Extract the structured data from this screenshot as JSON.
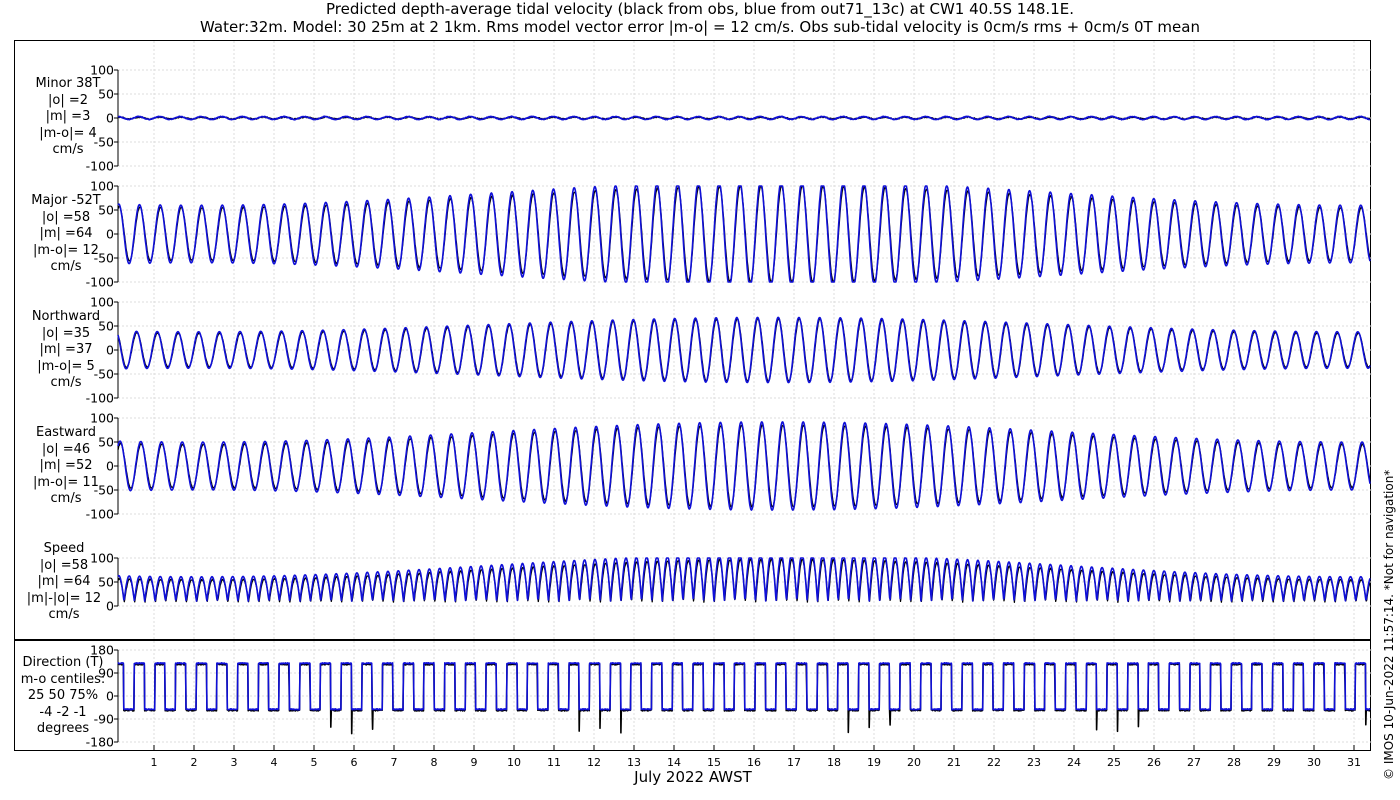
{
  "title_line1": "Predicted depth-average tidal velocity (black from obs, blue from out71_13c) at CW1 40.5S 148.1E.",
  "title_line2": "Water:32m. Model: 30 25m at 2 1km. Rms model vector error |m-o| = 12 cm/s. Obs sub-tidal velocity is 0cm/s rms + 0cm/s 0T mean",
  "watermark": "© IMOS 10-Jun-2022 11:57:14. *Not for navigation*",
  "panels": [
    {
      "key": "minor",
      "labels": [
        "Minor 38T",
        "|o| =2",
        "|m| =3",
        "|m-o|= 4",
        "cm/s"
      ]
    },
    {
      "key": "major",
      "labels": [
        "Major -52T",
        "|o| =58",
        "|m| =64",
        "|m-o|= 12",
        "cm/s"
      ]
    },
    {
      "key": "north",
      "labels": [
        "Northward",
        "|o| =35",
        "|m| =37",
        "|m-o|= 5",
        "cm/s"
      ]
    },
    {
      "key": "east",
      "labels": [
        "Eastward",
        "|o| =46",
        "|m| =52",
        "|m-o|= 11",
        "cm/s"
      ]
    },
    {
      "key": "speed",
      "labels": [
        "Speed",
        "|o| =58",
        "|m| =64",
        "|m|-|o|= 12",
        "cm/s"
      ]
    },
    {
      "key": "direction",
      "labels": [
        "Direction (T)",
        "m-o centiles:",
        "25  50  75%",
        "-4 -2 -1",
        "degrees"
      ]
    }
  ],
  "chart_data": {
    "type": "line",
    "xlabel": "July 2022 AWST",
    "x_ticks": [
      "1",
      "2",
      "3",
      "4",
      "5",
      "6",
      "7",
      "8",
      "9",
      "10",
      "11",
      "12",
      "13",
      "14",
      "15",
      "16",
      "17",
      "18",
      "19",
      "20",
      "21",
      "22",
      "23",
      "24",
      "25",
      "26",
      "27",
      "28",
      "29",
      "30",
      "31"
    ],
    "series_colors": {
      "obs": "#000000",
      "model": "#1010d8"
    },
    "grid": true,
    "panels": [
      {
        "name": "Minor 38T",
        "ylim": [
          -100,
          100
        ],
        "yticks": [
          "100",
          "50",
          "0",
          "-50",
          "-100"
        ],
        "obs_amplitude": 2,
        "model_amplitude": 3
      },
      {
        "name": "Major -52T",
        "ylim": [
          -100,
          100
        ],
        "yticks": [
          "100",
          "50",
          "0",
          "-50",
          "-100"
        ],
        "obs_amplitude_range": [
          55,
          100
        ],
        "model_amplitude_range": [
          60,
          110
        ]
      },
      {
        "name": "Northward",
        "ylim": [
          -100,
          100
        ],
        "yticks": [
          "100",
          "50",
          "0",
          "-50",
          "-100"
        ],
        "obs_amplitude_range": [
          35,
          65
        ],
        "model_amplitude_range": [
          38,
          68
        ]
      },
      {
        "name": "Eastward",
        "ylim": [
          -100,
          100
        ],
        "yticks": [
          "100",
          "50",
          "0",
          "-50",
          "-100"
        ],
        "obs_amplitude_range": [
          45,
          85
        ],
        "model_amplitude_range": [
          50,
          92
        ]
      },
      {
        "name": "Speed",
        "ylim": [
          0,
          100
        ],
        "yticks": [
          "100",
          "50",
          "0"
        ],
        "obs_peak_range": [
          55,
          105
        ],
        "model_peak_range": [
          60,
          115
        ]
      },
      {
        "name": "Direction (T)",
        "ylim": [
          -180,
          180
        ],
        "yticks": [
          "180",
          "90",
          "0",
          "-90",
          "-180"
        ],
        "levels": [
          128,
          -52
        ]
      }
    ]
  }
}
